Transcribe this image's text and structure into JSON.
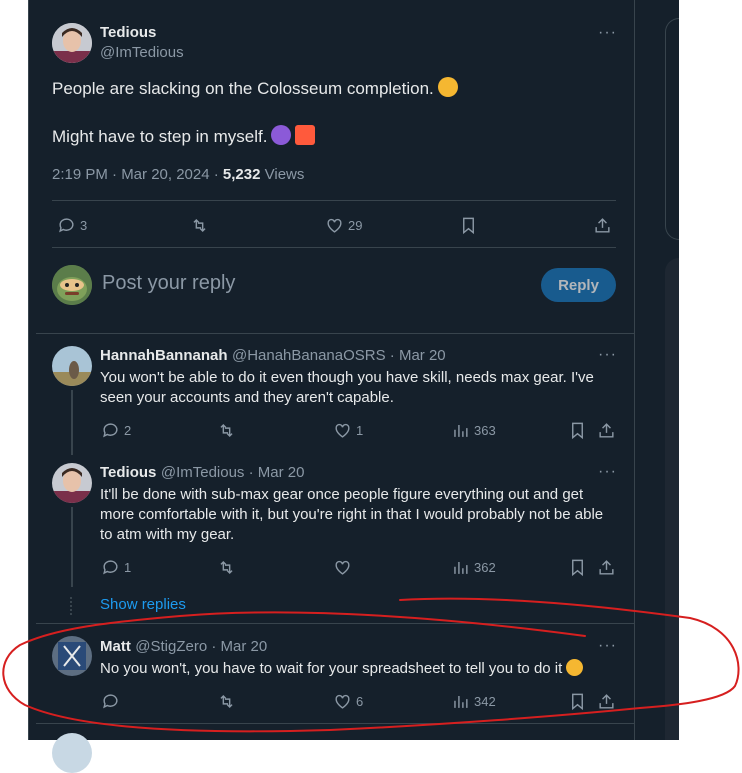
{
  "main_post": {
    "name": "Tedious",
    "handle": "@ImTedious",
    "line1": "People are slacking on the Colosseum completion.",
    "line2": "Might have to step in myself.",
    "time": "2:19 PM · Mar 20, 2024 · ",
    "views_count": "5,232",
    "views_label": " Views",
    "replies": "3",
    "likes": "29"
  },
  "composer": {
    "placeholder": "Post your reply",
    "button": "Reply"
  },
  "replies": [
    {
      "name": "HannahBannanah",
      "handle": "@HanahBananaOSRS · Mar 20",
      "text": "You won't be able to do it even though you have skill, needs max gear. I've seen your accounts and they aren't capable.",
      "replies": "2",
      "likes": "1",
      "views": "363"
    },
    {
      "name": "Tedious",
      "handle": "@ImTedious · Mar 20",
      "text": "It'll be done with sub-max gear once people figure everything out and get more comfortable with it, but you're right in that I would probably not be able to atm with my gear.",
      "replies": "1",
      "likes": "",
      "views": "362"
    },
    {
      "name": "Matt",
      "handle": "@StigZero · Mar 20",
      "text": "No you won't, you have to wait for your spreadsheet to tell you to do it",
      "replies": "",
      "likes": "6",
      "views": "342"
    }
  ],
  "show_replies": "Show replies",
  "more_symbol": "···",
  "colors": {
    "background": "#15202b",
    "accent": "#1d9bf0",
    "annotation": "#d61f1f"
  }
}
